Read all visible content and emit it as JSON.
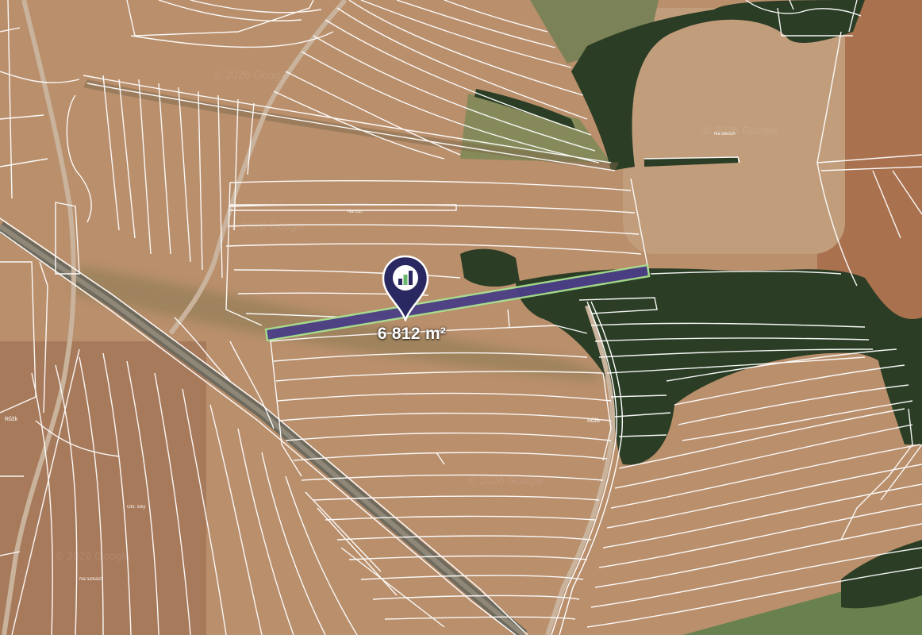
{
  "map": {
    "type": "satellite-cadastral",
    "colors": {
      "field": "#b98f6c",
      "forest": "#2b3d25",
      "parcel_lines": "#ffffff",
      "selected_parcel": "#4b3f86",
      "selected_border": "#a8e08f",
      "marker": "#2a2860"
    }
  },
  "marker": {
    "icon": "map-pin-with-bar-chart-icon",
    "area_label": "6 812 m²"
  },
  "place_labels": {
    "na_daccin": "Na dáccin",
    "na_luzk": "Na luží",
    "ruzk_center": "Růžk",
    "ruzk_left": "Růžk",
    "okrajni": "Okr. šíky",
    "na_lucki": "Na lučkách"
  },
  "watermarks": [
    "© 2026 Google",
    "© 2026 Google",
    "© 2026 Google",
    "© 2026 Google",
    "© 2026 Google"
  ]
}
